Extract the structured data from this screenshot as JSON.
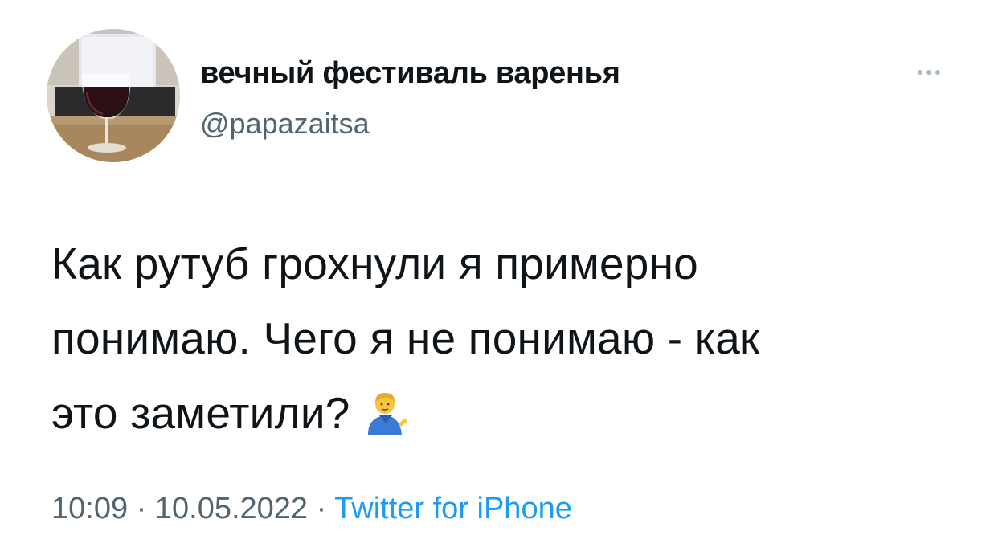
{
  "tweet": {
    "author": {
      "display_name": "вечный фестиваль варенья",
      "handle": "@papazaitsa"
    },
    "text_lines": [
      "Как рутуб грохнули я примерно",
      "понимаю. Чего я не понимаю - как",
      "это заметили?"
    ],
    "emoji": "man-tipping-hand-icon",
    "time": "10:09",
    "separator": "·",
    "date": "10.05.2022",
    "source": "Twitter for iPhone"
  },
  "colors": {
    "text": "#0f1419",
    "secondary": "#536471",
    "link": "#1d9bf0",
    "more_dots": "#aab8c2"
  }
}
